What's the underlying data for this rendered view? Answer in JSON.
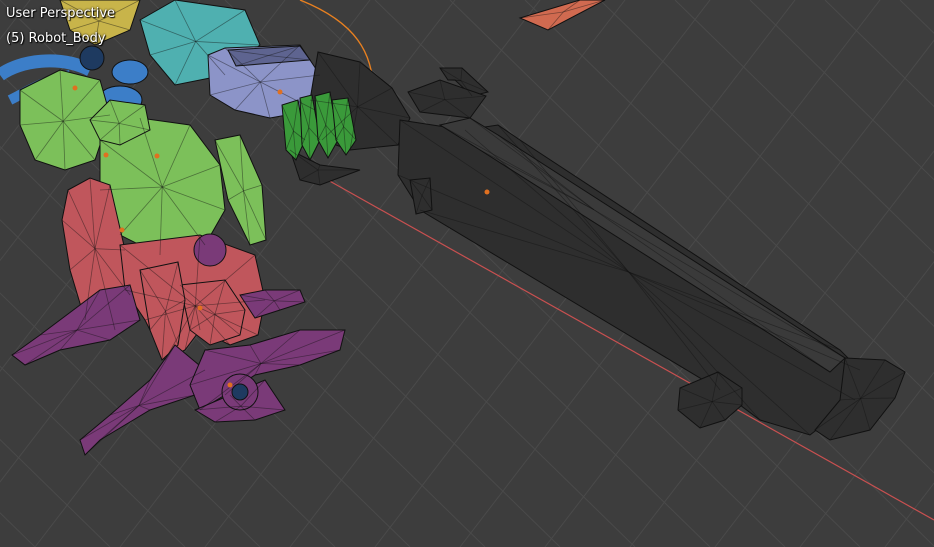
{
  "viewport": {
    "view_label": "User Perspective",
    "object_label": "(5) Robot_Body",
    "background_color": "#3d3d3d",
    "grid_color": "#4a4a4a",
    "axis_color": "#c85050"
  },
  "scene": {
    "mesh_colors": {
      "head_yellow": "#c8b44a",
      "cyan_arm": "#4fb0b0",
      "lavender_wrist": "#8c94c8",
      "dark_gun": "#2e2e2e",
      "green_torso": "#7cc05a",
      "blue_tubes": "#3c7ec8",
      "red_legs": "#c0565c",
      "purple_feet": "#7a3a78",
      "hand_green": "#3a9a3a",
      "origin_dot": "#e07020",
      "orange_curve": "#e88020"
    },
    "wire_color": "#111111"
  }
}
